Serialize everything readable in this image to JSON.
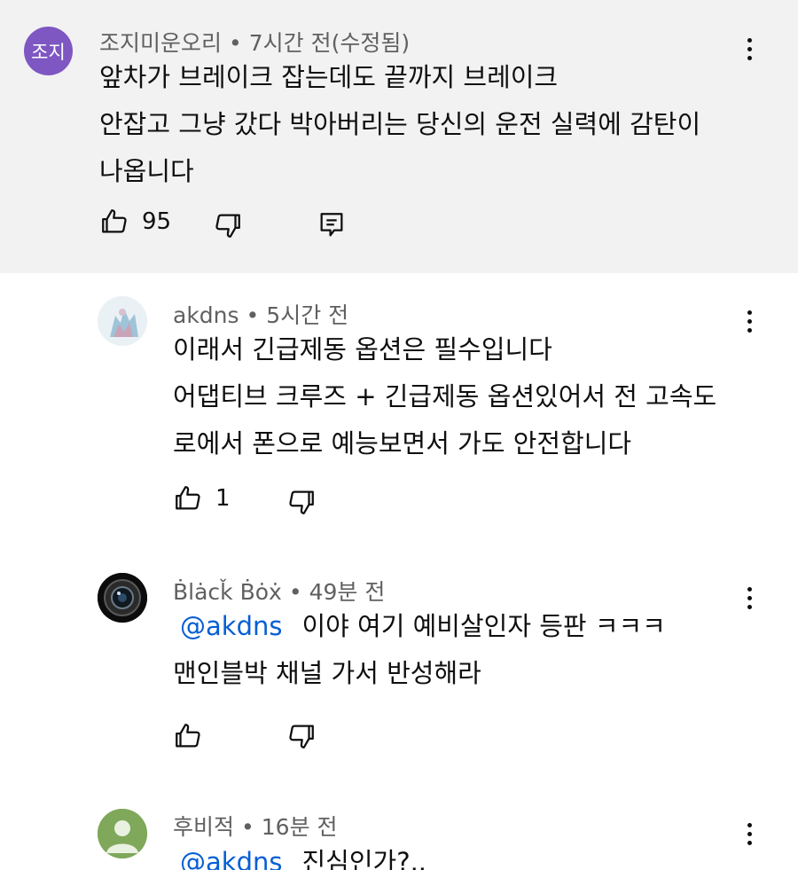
{
  "comments": [
    {
      "avatar_text": "조지",
      "avatar_color": "#7e57c2",
      "author": "조지미운오리",
      "time": "7시간 전(수정됨)",
      "lines": [
        "앞차가 브레이크 잡는데도  끝까지  브레이크",
        "안잡고 그냥 갔다 박아버리는 당신의 운전 실력에 감탄이",
        "나옵니다"
      ],
      "likes": "95"
    }
  ],
  "replies": [
    {
      "author": "akdns",
      "time": "5시간 전",
      "lines": [
        "이래서 긴급제동 옵션은 필수입니다",
        "어댑티브 크루즈 + 긴급제동 옵션있어서  전 고속도",
        "로에서 폰으로 예능보면서 가도 안전합니다"
      ],
      "likes": "1"
    },
    {
      "author": "Ḃlȧcǩ Ḃȯẋ",
      "time": "49분 전",
      "mention": "@akdns",
      "lines": [
        "이야 여기 예비살인자 등판 ㅋㅋㅋ",
        "맨인블박 채널 가서 반성해라"
      ],
      "likes": ""
    },
    {
      "author": "후비적",
      "time": "16분 전",
      "mention": "@akdns",
      "lines": [
        "진심인가?.."
      ],
      "avatar_color": "#7fa85a"
    }
  ],
  "separator": "•",
  "icons": [
    "thumbs-up-icon",
    "thumbs-down-icon",
    "reply-icon",
    "more-vert-icon"
  ]
}
